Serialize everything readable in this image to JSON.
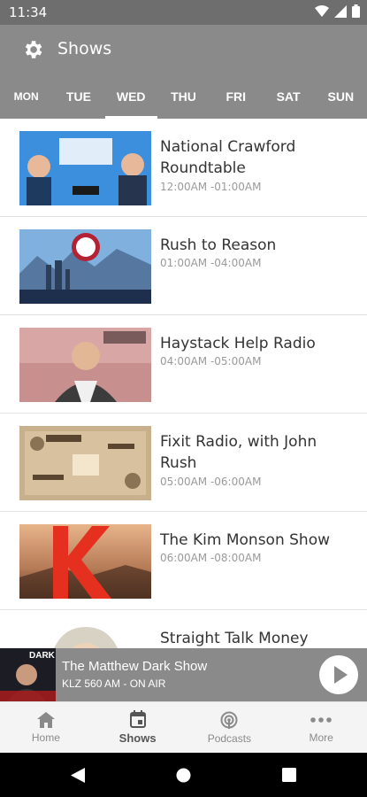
{
  "status_bar": {
    "time": "11:34"
  },
  "header": {
    "title": "Shows"
  },
  "days": [
    {
      "label": "MON",
      "active": false
    },
    {
      "label": "TUE",
      "active": false
    },
    {
      "label": "WED",
      "active": true
    },
    {
      "label": "THU",
      "active": false
    },
    {
      "label": "FRI",
      "active": false
    },
    {
      "label": "SAT",
      "active": false
    },
    {
      "label": "SUN",
      "active": false
    }
  ],
  "shows": [
    {
      "title": "National Crawford Roundtable",
      "time": "12:00AM -01:00AM"
    },
    {
      "title": "Rush to Reason",
      "time": "01:00AM -04:00AM"
    },
    {
      "title": "Haystack Help Radio",
      "time": "04:00AM -05:00AM"
    },
    {
      "title": "Fixit Radio, with John Rush",
      "time": "05:00AM -06:00AM"
    },
    {
      "title": "The Kim Monson Show",
      "time": "06:00AM -08:00AM"
    },
    {
      "title": "Straight Talk Money",
      "time": ""
    }
  ],
  "now_playing": {
    "title": "The Matthew Dark Show",
    "subtitle": "KLZ 560 AM - ON AIR",
    "thumb_text": "DARK"
  },
  "bottom_nav": [
    {
      "label": "Home",
      "icon": "home-icon",
      "active": false
    },
    {
      "label": "Shows",
      "icon": "calendar-icon",
      "active": true
    },
    {
      "label": "Podcasts",
      "icon": "podcast-icon",
      "active": false
    },
    {
      "label": "More",
      "icon": "more-icon",
      "active": false
    }
  ],
  "colors": {
    "header_bg": "#8a8a8a",
    "status_bg": "#6e6e6e",
    "title_text": "#333333",
    "time_text": "#9a9a9a"
  }
}
